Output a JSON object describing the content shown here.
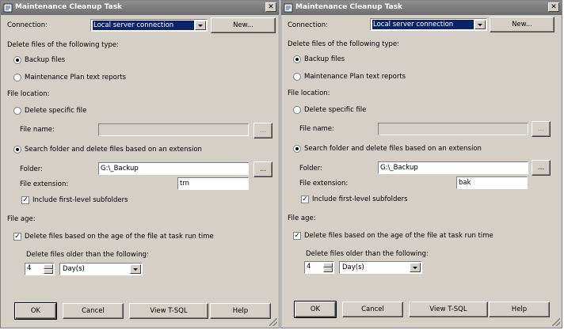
{
  "windows": [
    {
      "title": "Maintenance Cleanup Task",
      "connection_label": "Connection:",
      "connection_value": "Local server connection",
      "new_button": "New...",
      "file_type_label": "Delete files of the following type:",
      "backup_files": "Backup files",
      "maintenance_reports": "Maintenance Plan text reports",
      "file_location_label": "File location:",
      "delete_specific": "Delete specific file",
      "file_name_label": "File name:",
      "browse": "...",
      "search_folder": "Search folder and delete files based on an extension",
      "folder_label": "Folder:",
      "folder_value": "G:\\_Backup",
      "extension_label": "File extension:",
      "extension_value": "trn",
      "include_subfolders": "Include first-level subfolders",
      "file_age_label": "File age:",
      "delete_age": "Delete files based on the age of the file at task run time",
      "older_than_label": "Delete files older than the following:",
      "age_number": "4",
      "age_unit": "Day(s)",
      "ok": "OK",
      "cancel": "Cancel",
      "view_tsql": "View T-SQL",
      "help": "Help"
    },
    {
      "title": "Maintenance Cleanup Task",
      "connection_label": "Connection:",
      "connection_value": "Local server connection",
      "new_button": "New...",
      "file_type_label": "Delete files of the following type:",
      "backup_files": "Backup files",
      "maintenance_reports": "Maintenance Plan text reports",
      "file_location_label": "File location:",
      "delete_specific": "Delete specific file",
      "file_name_label": "File name:",
      "browse": "...",
      "search_folder": "Search folder and delete files based on an extension",
      "folder_label": "Folder:",
      "folder_value": "G:\\_Backup",
      "extension_label": "File extension:",
      "extension_value": "bak",
      "include_subfolders": "Include first-level subfolders",
      "file_age_label": "File age:",
      "delete_age": "Delete files based on the age of the file at task run time",
      "older_than_label": "Delete files older than the following:",
      "age_number": "4",
      "age_unit": "Day(s)",
      "ok": "OK",
      "cancel": "Cancel",
      "view_tsql": "View T-SQL",
      "help": "Help"
    }
  ]
}
